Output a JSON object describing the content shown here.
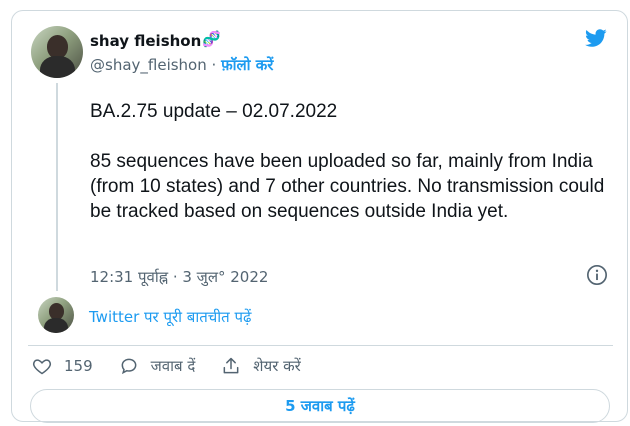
{
  "author": {
    "name": "shay fleishon",
    "name_emoji": "🧬",
    "handle": "@shay_fleishon",
    "separator": " · ",
    "follow_label": "फ़ॉलो करें"
  },
  "tweet": {
    "text": "BA.2.75 update – 02.07.2022\n\n85 sequences have been uploaded so far, mainly from India (from 10 states) and 7 other countries. No transmission could be tracked based on sequences outside India yet.",
    "timestamp": "12:31 पूर्वाह्न · 3 जुल° 2022"
  },
  "conversation": {
    "link_label": "Twitter पर पूरी बातचीत पढ़ें"
  },
  "actions": {
    "like_count": "159",
    "reply_label": "जवाब दें",
    "share_label": "शेयर करें"
  },
  "replies_button": {
    "label": "5 जवाब पढ़ें"
  },
  "colors": {
    "accent": "#1d9bf0",
    "text": "#0f1419",
    "muted": "#536471",
    "border": "#cfd9de"
  }
}
